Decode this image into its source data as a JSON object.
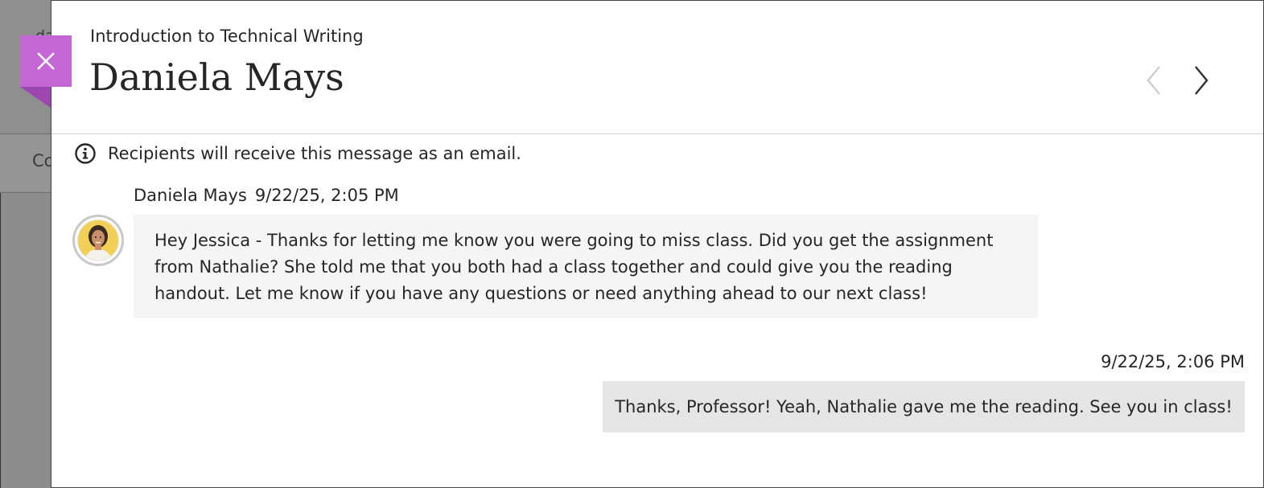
{
  "background": {
    "top_text": "da",
    "tab_text": "Co"
  },
  "header": {
    "course_name": "Introduction to Technical Writing",
    "title": "Daniela Mays",
    "close_icon": "close-icon",
    "prev_icon": "chevron-left-icon",
    "next_icon": "chevron-right-icon"
  },
  "notice": {
    "icon": "info-icon",
    "text": "Recipients will receive this message as an email."
  },
  "messages": [
    {
      "sender": "Daniela Mays",
      "timestamp": "9/22/25, 2:05 PM",
      "text": "Hey Jessica - Thanks for letting me know you were going to miss class. Did you get the assignment from Nathalie? She told me that you both had a class together and could give you the reading handout. Let me know if you have any questions or need anything ahead to our next class!"
    },
    {
      "timestamp": "9/22/25, 2:06 PM",
      "text": "Thanks, Professor! Yeah, Nathalie gave me the reading. See you in class!"
    }
  ],
  "colors": {
    "close_accent": "#c466d6",
    "incoming_bubble": "#f5f5f5",
    "outgoing_bubble": "#e5e5e5"
  }
}
